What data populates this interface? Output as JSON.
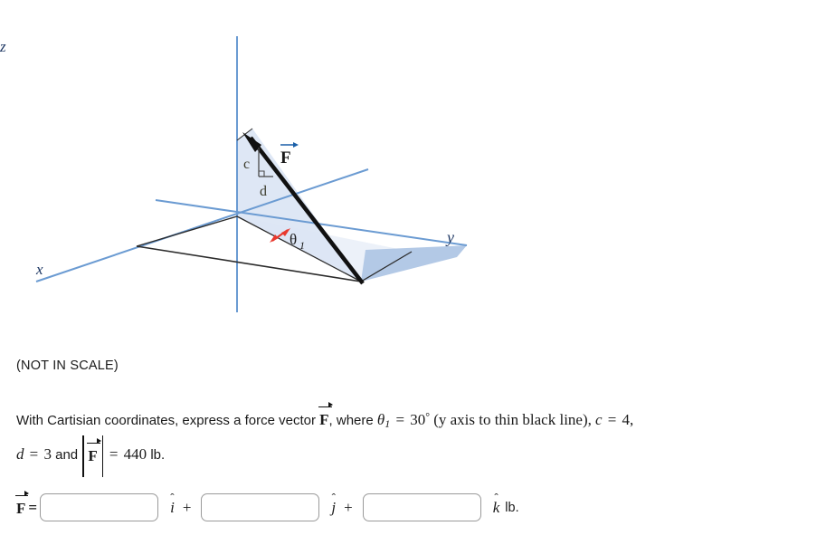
{
  "figure": {
    "axis_labels": {
      "x": "x",
      "y": "y",
      "z": "z"
    },
    "force_label": "F",
    "leg_vertical_label": "c",
    "leg_horizontal_label": "d",
    "angle_label": "θ",
    "angle_subscript": "1",
    "colors": {
      "axis_blue": "#6b9bd2",
      "plane_light": "#dce6f4",
      "plane_dark": "#b3c9e6",
      "outline_black": "#2b2b2b",
      "force_black": "#111111",
      "angle_red": "#e8392e",
      "label_navy": "#1f3864"
    },
    "caption": "(NOT IN SCALE)"
  },
  "question": {
    "line1_part1": "With Cartisian coordinates, express a force vector",
    "line1_force": "F",
    "line1_part2": ", where",
    "theta": "θ",
    "theta_sub": "1",
    "equals": "=",
    "theta_value": "30",
    "degree": "°",
    "theta_note": "(y axis to thin black line),",
    "c_symbol": "c",
    "c_value": "4,",
    "d_symbol": "d",
    "d_value": "3",
    "and_word": "and",
    "magnitude_force": "F",
    "magnitude_value": "440",
    "magnitude_unit": "lb."
  },
  "answer": {
    "prefix_force": "F",
    "equals": "=",
    "i_value": "",
    "j_value": "",
    "k_value": "",
    "placeholder": "",
    "i_label": "i",
    "j_label": "j",
    "k_label": "k",
    "hat": "ˆ",
    "plus": "+",
    "unit": "lb."
  }
}
